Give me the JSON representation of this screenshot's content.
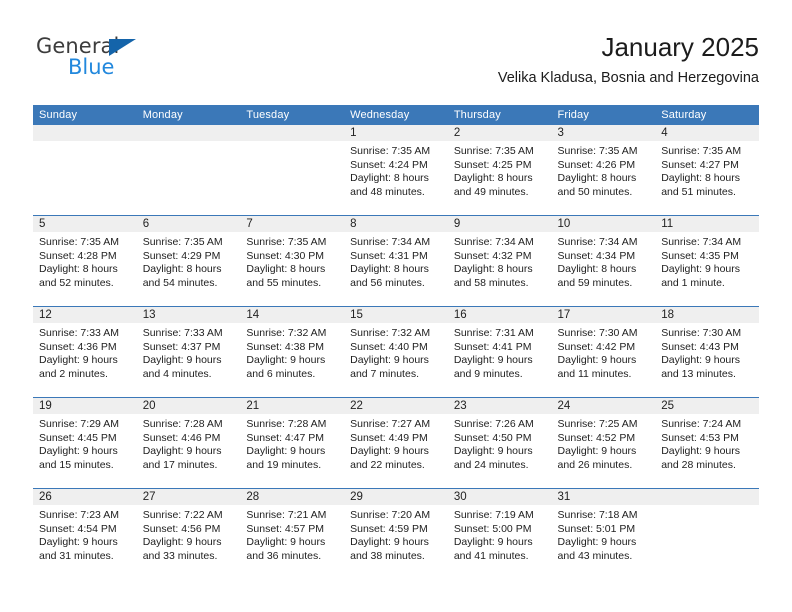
{
  "brand": {
    "name_part1": "General",
    "name_part2": "Blue",
    "logo_icon": "triangle-icon",
    "color_dark": "#3c3c3c",
    "color_blue": "#2288dd",
    "color_triangle": "#1464aa"
  },
  "header": {
    "title": "January 2025",
    "subtitle": "Velika Kladusa, Bosnia and Herzegovina"
  },
  "theme": {
    "header_blue": "#3b78b8",
    "daynum_band": "#efefef",
    "text": "#1e1e1e"
  },
  "weekday_headers": [
    "Sunday",
    "Monday",
    "Tuesday",
    "Wednesday",
    "Thursday",
    "Friday",
    "Saturday"
  ],
  "weeks": [
    [
      {
        "day": "",
        "lines": []
      },
      {
        "day": "",
        "lines": []
      },
      {
        "day": "",
        "lines": []
      },
      {
        "day": "1",
        "lines": [
          "Sunrise: 7:35 AM",
          "Sunset: 4:24 PM",
          "Daylight: 8 hours",
          "and 48 minutes."
        ]
      },
      {
        "day": "2",
        "lines": [
          "Sunrise: 7:35 AM",
          "Sunset: 4:25 PM",
          "Daylight: 8 hours",
          "and 49 minutes."
        ]
      },
      {
        "day": "3",
        "lines": [
          "Sunrise: 7:35 AM",
          "Sunset: 4:26 PM",
          "Daylight: 8 hours",
          "and 50 minutes."
        ]
      },
      {
        "day": "4",
        "lines": [
          "Sunrise: 7:35 AM",
          "Sunset: 4:27 PM",
          "Daylight: 8 hours",
          "and 51 minutes."
        ]
      }
    ],
    [
      {
        "day": "5",
        "lines": [
          "Sunrise: 7:35 AM",
          "Sunset: 4:28 PM",
          "Daylight: 8 hours",
          "and 52 minutes."
        ]
      },
      {
        "day": "6",
        "lines": [
          "Sunrise: 7:35 AM",
          "Sunset: 4:29 PM",
          "Daylight: 8 hours",
          "and 54 minutes."
        ]
      },
      {
        "day": "7",
        "lines": [
          "Sunrise: 7:35 AM",
          "Sunset: 4:30 PM",
          "Daylight: 8 hours",
          "and 55 minutes."
        ]
      },
      {
        "day": "8",
        "lines": [
          "Sunrise: 7:34 AM",
          "Sunset: 4:31 PM",
          "Daylight: 8 hours",
          "and 56 minutes."
        ]
      },
      {
        "day": "9",
        "lines": [
          "Sunrise: 7:34 AM",
          "Sunset: 4:32 PM",
          "Daylight: 8 hours",
          "and 58 minutes."
        ]
      },
      {
        "day": "10",
        "lines": [
          "Sunrise: 7:34 AM",
          "Sunset: 4:34 PM",
          "Daylight: 8 hours",
          "and 59 minutes."
        ]
      },
      {
        "day": "11",
        "lines": [
          "Sunrise: 7:34 AM",
          "Sunset: 4:35 PM",
          "Daylight: 9 hours",
          "and 1 minute."
        ]
      }
    ],
    [
      {
        "day": "12",
        "lines": [
          "Sunrise: 7:33 AM",
          "Sunset: 4:36 PM",
          "Daylight: 9 hours",
          "and 2 minutes."
        ]
      },
      {
        "day": "13",
        "lines": [
          "Sunrise: 7:33 AM",
          "Sunset: 4:37 PM",
          "Daylight: 9 hours",
          "and 4 minutes."
        ]
      },
      {
        "day": "14",
        "lines": [
          "Sunrise: 7:32 AM",
          "Sunset: 4:38 PM",
          "Daylight: 9 hours",
          "and 6 minutes."
        ]
      },
      {
        "day": "15",
        "lines": [
          "Sunrise: 7:32 AM",
          "Sunset: 4:40 PM",
          "Daylight: 9 hours",
          "and 7 minutes."
        ]
      },
      {
        "day": "16",
        "lines": [
          "Sunrise: 7:31 AM",
          "Sunset: 4:41 PM",
          "Daylight: 9 hours",
          "and 9 minutes."
        ]
      },
      {
        "day": "17",
        "lines": [
          "Sunrise: 7:30 AM",
          "Sunset: 4:42 PM",
          "Daylight: 9 hours",
          "and 11 minutes."
        ]
      },
      {
        "day": "18",
        "lines": [
          "Sunrise: 7:30 AM",
          "Sunset: 4:43 PM",
          "Daylight: 9 hours",
          "and 13 minutes."
        ]
      }
    ],
    [
      {
        "day": "19",
        "lines": [
          "Sunrise: 7:29 AM",
          "Sunset: 4:45 PM",
          "Daylight: 9 hours",
          "and 15 minutes."
        ]
      },
      {
        "day": "20",
        "lines": [
          "Sunrise: 7:28 AM",
          "Sunset: 4:46 PM",
          "Daylight: 9 hours",
          "and 17 minutes."
        ]
      },
      {
        "day": "21",
        "lines": [
          "Sunrise: 7:28 AM",
          "Sunset: 4:47 PM",
          "Daylight: 9 hours",
          "and 19 minutes."
        ]
      },
      {
        "day": "22",
        "lines": [
          "Sunrise: 7:27 AM",
          "Sunset: 4:49 PM",
          "Daylight: 9 hours",
          "and 22 minutes."
        ]
      },
      {
        "day": "23",
        "lines": [
          "Sunrise: 7:26 AM",
          "Sunset: 4:50 PM",
          "Daylight: 9 hours",
          "and 24 minutes."
        ]
      },
      {
        "day": "24",
        "lines": [
          "Sunrise: 7:25 AM",
          "Sunset: 4:52 PM",
          "Daylight: 9 hours",
          "and 26 minutes."
        ]
      },
      {
        "day": "25",
        "lines": [
          "Sunrise: 7:24 AM",
          "Sunset: 4:53 PM",
          "Daylight: 9 hours",
          "and 28 minutes."
        ]
      }
    ],
    [
      {
        "day": "26",
        "lines": [
          "Sunrise: 7:23 AM",
          "Sunset: 4:54 PM",
          "Daylight: 9 hours",
          "and 31 minutes."
        ]
      },
      {
        "day": "27",
        "lines": [
          "Sunrise: 7:22 AM",
          "Sunset: 4:56 PM",
          "Daylight: 9 hours",
          "and 33 minutes."
        ]
      },
      {
        "day": "28",
        "lines": [
          "Sunrise: 7:21 AM",
          "Sunset: 4:57 PM",
          "Daylight: 9 hours",
          "and 36 minutes."
        ]
      },
      {
        "day": "29",
        "lines": [
          "Sunrise: 7:20 AM",
          "Sunset: 4:59 PM",
          "Daylight: 9 hours",
          "and 38 minutes."
        ]
      },
      {
        "day": "30",
        "lines": [
          "Sunrise: 7:19 AM",
          "Sunset: 5:00 PM",
          "Daylight: 9 hours",
          "and 41 minutes."
        ]
      },
      {
        "day": "31",
        "lines": [
          "Sunrise: 7:18 AM",
          "Sunset: 5:01 PM",
          "Daylight: 9 hours",
          "and 43 minutes."
        ]
      },
      {
        "day": "",
        "lines": []
      }
    ]
  ]
}
